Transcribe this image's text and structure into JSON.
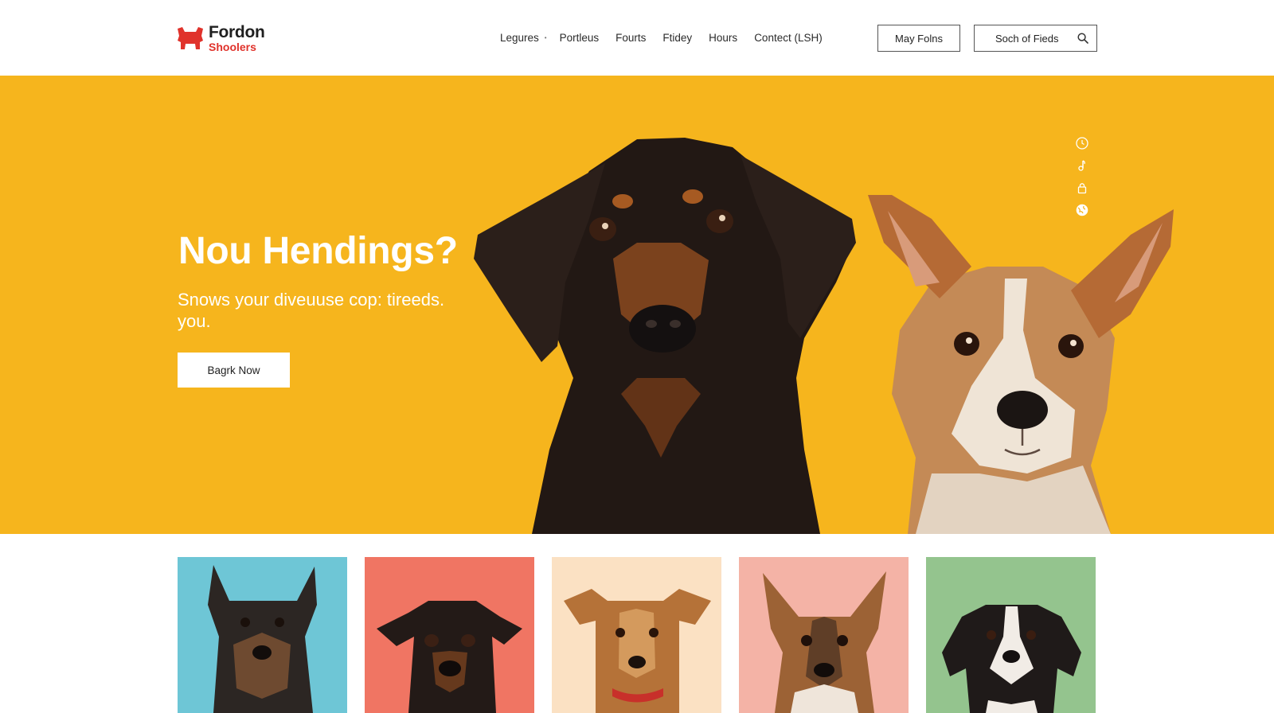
{
  "brand": {
    "name_line1": "Fordon",
    "name_line2": "Shoolers",
    "logo_icon": "red-dog-logo-icon",
    "accent_color": "#e0322b"
  },
  "nav": {
    "items": [
      {
        "label": "Legures"
      },
      {
        "label": "Portleus"
      },
      {
        "label": "Fourts"
      },
      {
        "label": "Ftidey"
      },
      {
        "label": "Hours"
      },
      {
        "label": "Contect (LSH)"
      }
    ],
    "separator": "•"
  },
  "header": {
    "primary_button": "May Folns",
    "search": {
      "label": "Soch of Fieds",
      "icon": "search-icon"
    }
  },
  "hero": {
    "title": "Nou Hendings?",
    "subtitle": "Snows your diveuuse cop: tireeds. you.",
    "cta": "Bagrk Now",
    "background_color": "#f6b51d",
    "side_icons": [
      "clock-icon",
      "music-note-icon",
      "lock-icon",
      "globe-icon"
    ],
    "images": [
      "black-and-tan-dog-portrait",
      "tan-and-white-terrier-portrait"
    ]
  },
  "gallery": {
    "items": [
      {
        "image": "dark-scruffy-terrier",
        "bg": "#6ec6d6"
      },
      {
        "image": "black-and-tan-puppy",
        "bg": "#f07563"
      },
      {
        "image": "tan-puppy-red-collar",
        "bg": "#fbe1c3"
      },
      {
        "image": "brown-pointy-eared-dog",
        "bg": "#f4b3a6"
      },
      {
        "image": "black-white-spaniel",
        "bg": "#94c48e"
      }
    ]
  }
}
